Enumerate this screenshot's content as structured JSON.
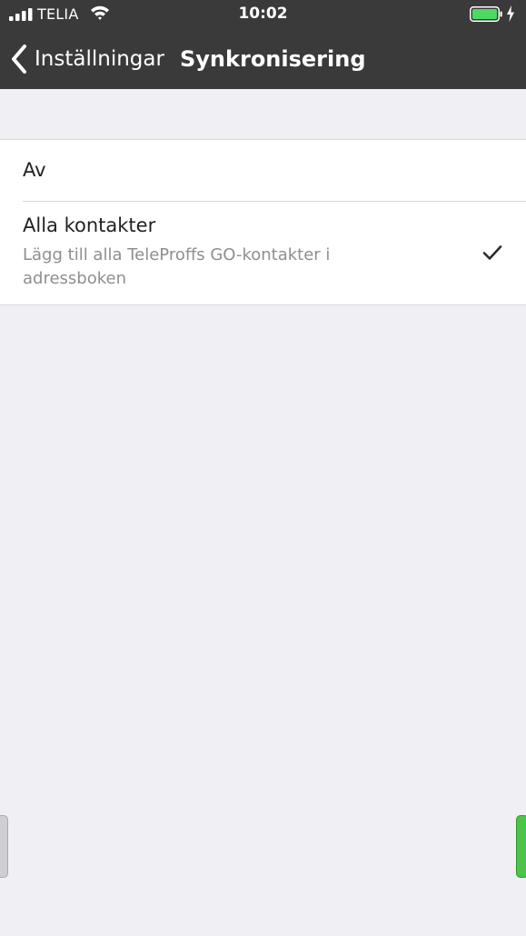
{
  "status_bar": {
    "carrier": "TELIA",
    "time": "10:02",
    "icons": [
      "signal-bars-icon",
      "wifi-icon",
      "battery-icon",
      "charging-bolt-icon"
    ],
    "battery_color": "#4cd964"
  },
  "nav": {
    "back_label": "Inställningar",
    "title": "Synkronisering",
    "bar_color": "#3a3a3a"
  },
  "options": [
    {
      "title": "Av",
      "selected": false
    },
    {
      "title": "Alla kontakter",
      "subtitle": "Lägg till alla TeleProffs GO-kontakter i adressboken",
      "selected": true
    }
  ],
  "colors": {
    "background": "#efeff4",
    "accent_green": "#4fc24a"
  }
}
